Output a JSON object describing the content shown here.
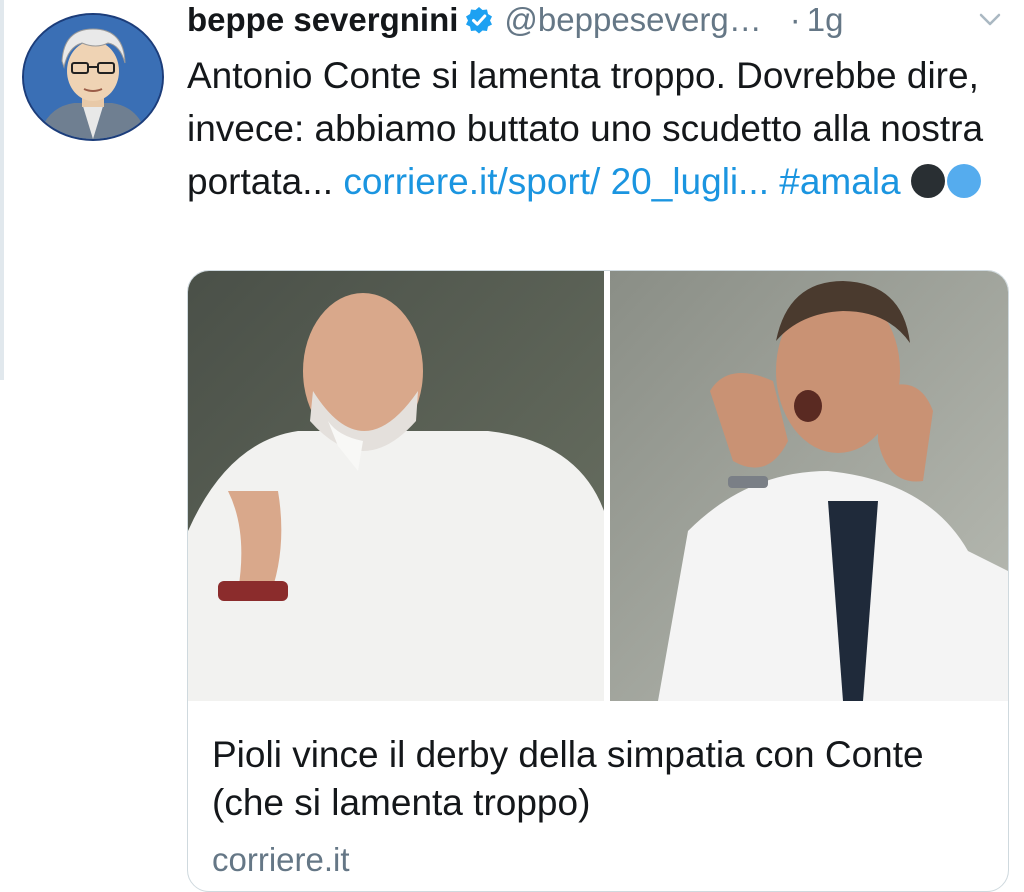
{
  "tweet": {
    "author_name": "beppe severgnini",
    "handle": "@beppeseverg…",
    "separator": "·",
    "time": "1g",
    "text_plain": "Antonio Conte si lamenta troppo.  Dovrebbe dire, invece: abbiamo buttato uno scudetto alla nostra portata...",
    "link_text": "corriere.it/sport/ 20_lugli...",
    "hashtag": "#amala",
    "emojis": [
      {
        "name": "black-circle",
        "color": "#292f33"
      },
      {
        "name": "blue-circle",
        "color": "#55acee"
      }
    ]
  },
  "card": {
    "title": "Pioli vince il derby della simpatia con Conte (che si lamenta troppo)",
    "domain": "corriere.it"
  },
  "colors": {
    "link": "#1b95e0",
    "secondary_text": "#657786",
    "verified_badge": "#1da1f2"
  }
}
